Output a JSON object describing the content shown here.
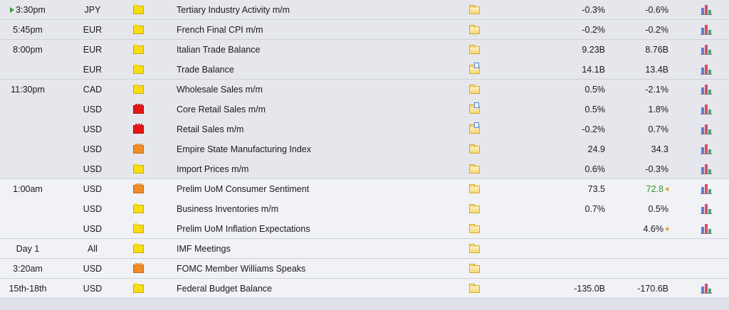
{
  "rows": [
    {
      "time": "3:30pm",
      "currency": "JPY",
      "impact": "yellow",
      "event": "Tertiary Industry Activity m/m",
      "detail_icon": "folder-icon",
      "actual": "-0.3%",
      "forecast": "-0.6%",
      "forecast_color": "",
      "has_graph": true,
      "current": true,
      "shade": "dark"
    },
    {
      "time": "5:45pm",
      "currency": "EUR",
      "impact": "yellow",
      "event": "French Final CPI m/m",
      "detail_icon": "folder-icon",
      "actual": "-0.2%",
      "forecast": "-0.2%",
      "has_graph": true,
      "shade": "dark"
    },
    {
      "time": "8:00pm",
      "currency": "EUR",
      "impact": "yellow",
      "event": "Italian Trade Balance",
      "detail_icon": "folder-icon",
      "actual": "9.23B",
      "forecast": "8.76B",
      "has_graph": true,
      "shade": "dark",
      "noborder": true
    },
    {
      "time": "",
      "currency": "EUR",
      "impact": "yellow",
      "event": "Trade Balance",
      "detail_icon": "folder-document-icon",
      "actual": "14.1B",
      "forecast": "13.4B",
      "has_graph": true,
      "shade": "dark"
    },
    {
      "time": "11:30pm",
      "currency": "CAD",
      "impact": "yellow",
      "event": "Wholesale Sales m/m",
      "detail_icon": "folder-icon",
      "actual": "0.5%",
      "forecast": "-2.1%",
      "has_graph": true,
      "shade": "dark",
      "noborder": true
    },
    {
      "time": "",
      "currency": "USD",
      "impact": "red",
      "event": "Core Retail Sales m/m",
      "detail_icon": "folder-document-icon",
      "actual": "0.5%",
      "forecast": "1.8%",
      "has_graph": true,
      "shade": "dark",
      "noborder": true
    },
    {
      "time": "",
      "currency": "USD",
      "impact": "red",
      "event": "Retail Sales m/m",
      "detail_icon": "folder-document-icon",
      "actual": "-0.2%",
      "forecast": "0.7%",
      "has_graph": true,
      "shade": "dark",
      "noborder": true
    },
    {
      "time": "",
      "currency": "USD",
      "impact": "orange",
      "event": "Empire State Manufacturing Index",
      "detail_icon": "folder-icon",
      "actual": "24.9",
      "forecast": "34.3",
      "has_graph": true,
      "shade": "dark",
      "noborder": true
    },
    {
      "time": "",
      "currency": "USD",
      "impact": "yellow",
      "event": "Import Prices m/m",
      "detail_icon": "folder-icon",
      "actual": "0.6%",
      "forecast": "-0.3%",
      "has_graph": true,
      "shade": "dark"
    },
    {
      "time": "1:00am",
      "currency": "USD",
      "impact": "orange",
      "event": "Prelim UoM Consumer Sentiment",
      "detail_icon": "folder-icon",
      "actual": "73.5",
      "forecast": "72.8",
      "forecast_green": true,
      "forecast_marker": true,
      "has_graph": true,
      "shade": "light",
      "noborder": true
    },
    {
      "time": "",
      "currency": "USD",
      "impact": "yellow",
      "event": "Business Inventories m/m",
      "detail_icon": "folder-icon",
      "actual": "0.7%",
      "forecast": "0.5%",
      "has_graph": true,
      "shade": "light",
      "noborder": true
    },
    {
      "time": "",
      "currency": "USD",
      "impact": "yellow",
      "event": "Prelim UoM Inflation Expectations",
      "detail_icon": "folder-icon",
      "actual": "",
      "forecast": "4.6%",
      "forecast_marker": true,
      "has_graph": true,
      "shade": "light"
    },
    {
      "time": "Day 1",
      "currency": "All",
      "impact": "yellow",
      "event": "IMF Meetings",
      "detail_icon": "folder-icon",
      "actual": "",
      "forecast": "",
      "has_graph": false,
      "shade": "light"
    },
    {
      "time": "3:20am",
      "currency": "USD",
      "impact": "orange",
      "event": "FOMC Member Williams Speaks",
      "detail_icon": "folder-icon",
      "actual": "",
      "forecast": "",
      "has_graph": false,
      "shade": "light"
    },
    {
      "time": "15th-18th",
      "currency": "USD",
      "impact": "yellow",
      "event": "Federal Budget Balance",
      "detail_icon": "folder-icon",
      "actual": "-135.0B",
      "forecast": "-170.6B",
      "has_graph": true,
      "shade": "light"
    }
  ]
}
